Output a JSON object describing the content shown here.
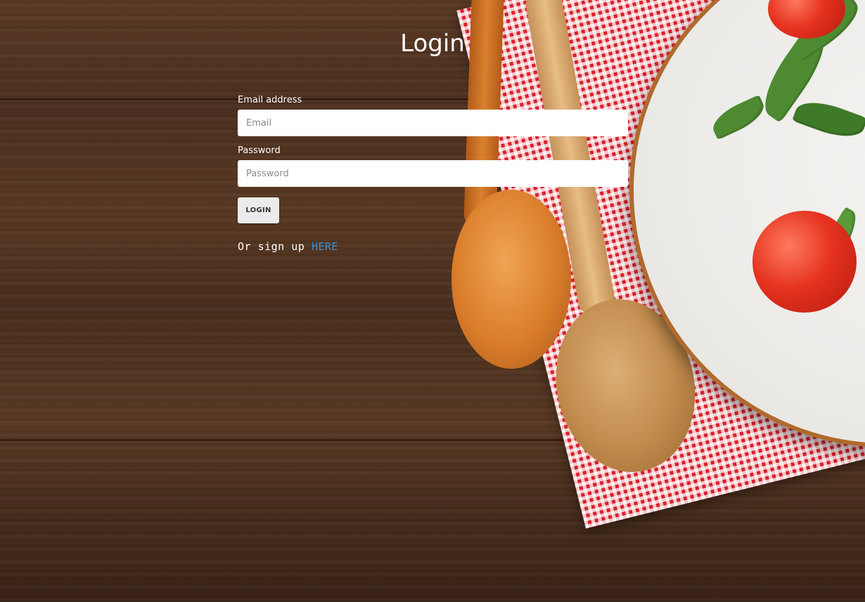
{
  "page": {
    "title": "Login"
  },
  "form": {
    "email_label": "Email address",
    "email_placeholder": "Email",
    "email_value": "",
    "password_label": "Password",
    "password_placeholder": "Password",
    "password_value": "",
    "submit_label": "LOGIN"
  },
  "signup": {
    "prefix": "Or sign up ",
    "link_label": "HERE"
  },
  "colors": {
    "title_text": "#ffffff",
    "link": "#3a8fd8",
    "button_bg": "#ebebeb"
  }
}
